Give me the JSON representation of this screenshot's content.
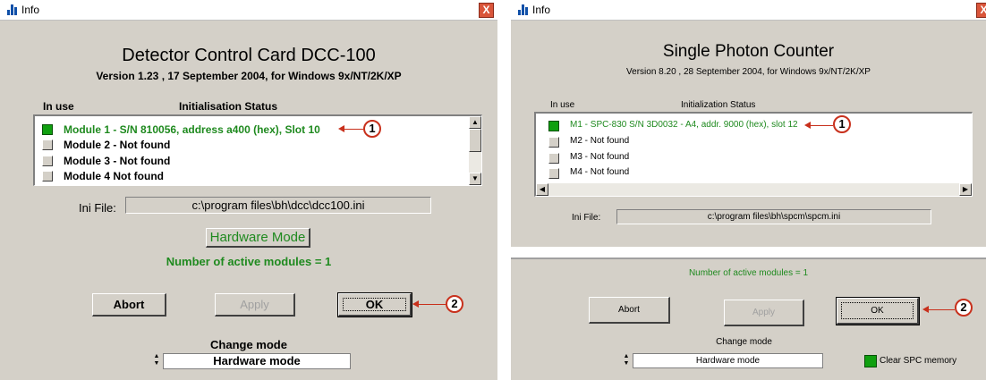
{
  "left": {
    "window_title": "Info",
    "close_glyph": "X",
    "title": "Detector Control Card DCC-100",
    "version": "Version 1.23 , 17 September 2004, for Windows 9x/NT/2K/XP",
    "col_in_use": "In use",
    "col_status": "Initialisation Status",
    "modules": [
      {
        "led": "on",
        "text": "Module 1 - S/N 810056, address a400 (hex), Slot 10"
      },
      {
        "led": "off",
        "text": "Module 2 -  Not found"
      },
      {
        "led": "off",
        "text": "Module 3 -  Not found"
      },
      {
        "led": "off",
        "text": "Module 4    Not found"
      }
    ],
    "ini_label": "Ini File:",
    "ini_path": "c:\\program files\\bh\\dcc\\dcc100.ini",
    "hardware_mode_button": "Hardware Mode",
    "active_modules": "Number of active modules = 1",
    "abort": "Abort",
    "apply": "Apply",
    "ok": "OK",
    "change_mode_label": "Change mode",
    "mode_value": "Hardware mode",
    "callout_1": "1",
    "callout_2": "2"
  },
  "right": {
    "window_title": "Info",
    "close_glyph": "X",
    "title": "Single Photon Counter",
    "version": "Version 8.20 , 28 September 2004, for Windows 9x/NT/2K/XP",
    "col_in_use": "In use",
    "col_status": "Initialization Status",
    "modules": [
      {
        "led": "on",
        "text": "M1 - SPC-830   S/N 3D0032 - A4, addr. 9000 (hex), slot 12"
      },
      {
        "led": "off",
        "text": "M2 - Not found"
      },
      {
        "led": "off",
        "text": "M3 - Not found"
      },
      {
        "led": "off",
        "text": "M4 - Not found"
      }
    ],
    "ini_label": "Ini File:",
    "ini_path": "c:\\program files\\bh\\spcm\\spcm.ini",
    "active_modules": "Number of active modules = 1",
    "abort": "Abort",
    "apply": "Apply",
    "ok": "OK",
    "change_mode_label": "Change mode",
    "mode_value": "Hardware mode",
    "clear_memory": "Clear SPC memory",
    "callout_1": "1",
    "callout_2": "2"
  },
  "colors": {
    "accent_green": "#1f8a1f",
    "callout_red": "#c8301c",
    "dialog_gray": "#d4d0c8"
  }
}
